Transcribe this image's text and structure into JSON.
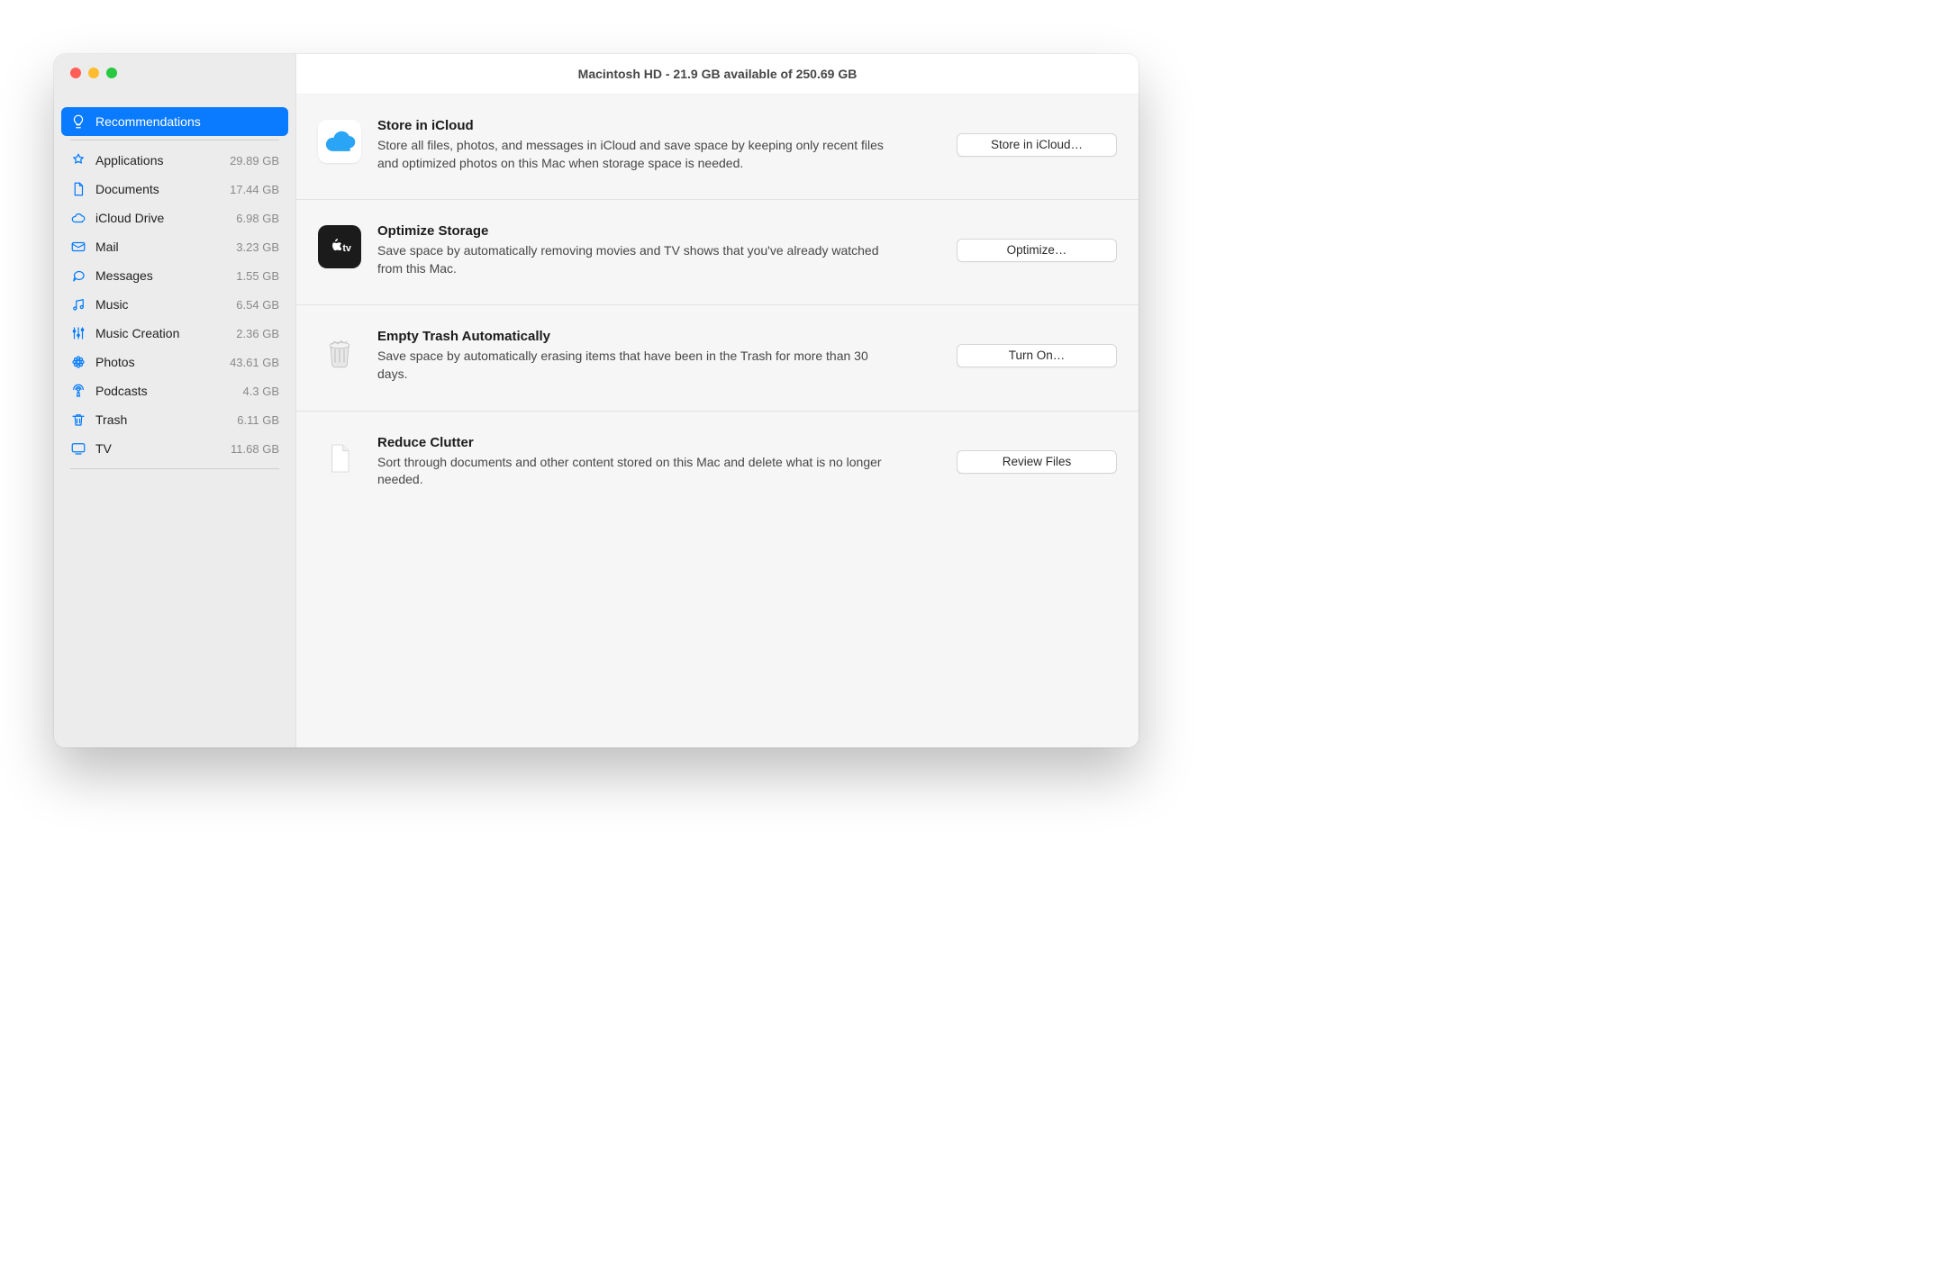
{
  "window": {
    "title": "Macintosh HD - 21.9 GB available of 250.69 GB"
  },
  "sidebar": {
    "selected": "Recommendations",
    "items": [
      {
        "icon": "lightbulb",
        "label": "Recommendations",
        "size": ""
      },
      {
        "icon": "app-a",
        "label": "Applications",
        "size": "29.89 GB"
      },
      {
        "icon": "doc",
        "label": "Documents",
        "size": "17.44 GB"
      },
      {
        "icon": "cloud",
        "label": "iCloud Drive",
        "size": "6.98 GB"
      },
      {
        "icon": "envelope",
        "label": "Mail",
        "size": "3.23 GB"
      },
      {
        "icon": "bubble",
        "label": "Messages",
        "size": "1.55 GB"
      },
      {
        "icon": "music",
        "label": "Music",
        "size": "6.54 GB"
      },
      {
        "icon": "mixer",
        "label": "Music Creation",
        "size": "2.36 GB"
      },
      {
        "icon": "flower",
        "label": "Photos",
        "size": "43.61 GB"
      },
      {
        "icon": "podcast",
        "label": "Podcasts",
        "size": "4.3 GB"
      },
      {
        "icon": "trash",
        "label": "Trash",
        "size": "6.11 GB"
      },
      {
        "icon": "tv",
        "label": "TV",
        "size": "11.68 GB"
      }
    ]
  },
  "recommendations": [
    {
      "id": "store-in-icloud",
      "icon": "cloud-app",
      "title": "Store in iCloud",
      "desc": "Store all files, photos, and messages in iCloud and save space by keeping only recent files and optimized photos on this Mac when storage space is needed.",
      "button": "Store in iCloud…"
    },
    {
      "id": "optimize-storage",
      "icon": "appletv-app",
      "title": "Optimize Storage",
      "desc": "Save space by automatically removing movies and TV shows that you've already watched from this Mac.",
      "button": "Optimize…"
    },
    {
      "id": "empty-trash",
      "icon": "trash-bin",
      "title": "Empty Trash Automatically",
      "desc": "Save space by automatically erasing items that have been in the Trash for more than 30 days.",
      "button": "Turn On…"
    },
    {
      "id": "reduce-clutter",
      "icon": "blank-doc",
      "title": "Reduce Clutter",
      "desc": "Sort through documents and other content stored on this Mac and delete what is no longer needed.",
      "button": "Review Files"
    }
  ]
}
